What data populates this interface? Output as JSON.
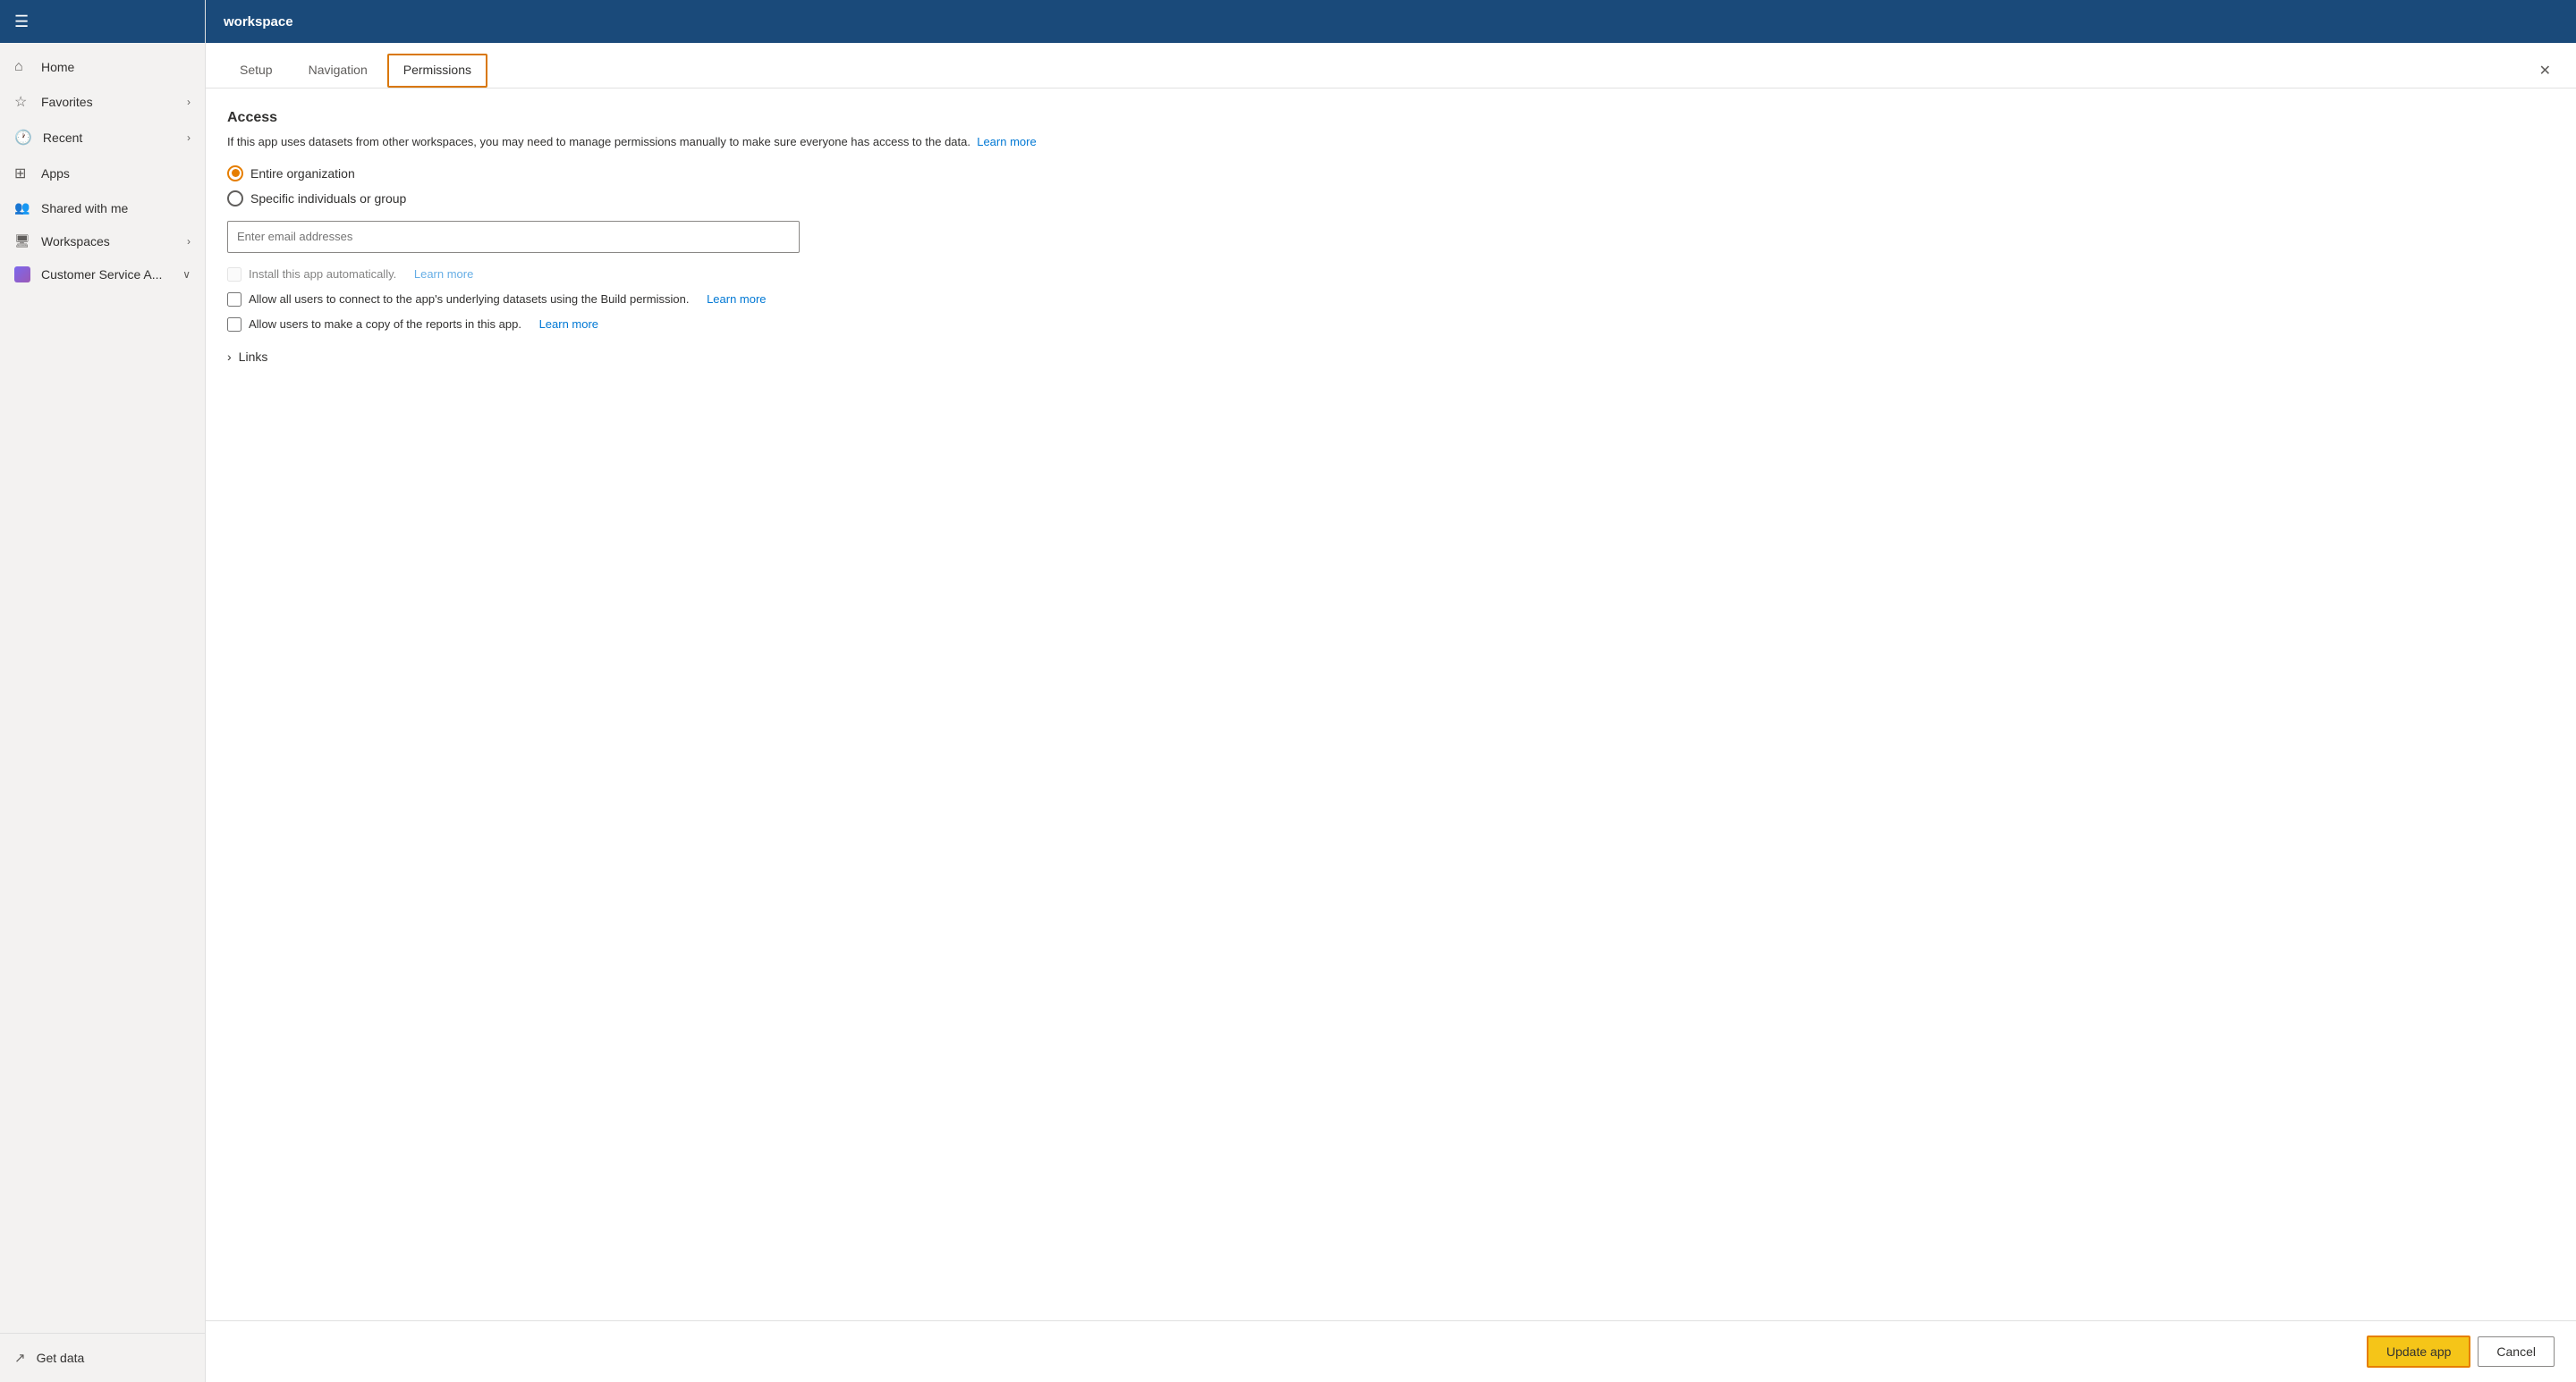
{
  "app_title": "workspace",
  "sidebar": {
    "menu_icon": "☰",
    "items": [
      {
        "id": "home",
        "label": "Home",
        "icon": "⌂"
      },
      {
        "id": "favorites",
        "label": "Favorites",
        "icon": "☆",
        "has_chevron": true
      },
      {
        "id": "recent",
        "label": "Recent",
        "icon": "🕐",
        "has_chevron": true
      },
      {
        "id": "apps",
        "label": "Apps",
        "icon": "⊞"
      },
      {
        "id": "shared",
        "label": "Shared with me",
        "icon": "👥"
      },
      {
        "id": "workspaces",
        "label": "Workspaces",
        "icon": "🖥",
        "has_chevron": true
      },
      {
        "id": "customer-service",
        "label": "Customer Service A...",
        "icon": "ws",
        "has_chevron": true
      }
    ],
    "footer": [
      {
        "id": "get-data",
        "label": "Get data",
        "icon": "↗"
      }
    ]
  },
  "tabs": [
    {
      "id": "setup",
      "label": "Setup",
      "active": false
    },
    {
      "id": "navigation",
      "label": "Navigation",
      "active": false
    },
    {
      "id": "permissions",
      "label": "Permissions",
      "active": true
    }
  ],
  "content": {
    "section_title": "Access",
    "section_desc": "If this app uses datasets from other workspaces, you may need to manage permissions manually to make sure everyone has access to the data.",
    "learn_more_1": "Learn more",
    "radio_entire_org": "Entire organization",
    "radio_specific": "Specific individuals or group",
    "email_placeholder": "Enter email addresses",
    "checkbox_install_label": "Install this app automatically.",
    "checkbox_install_learn_more": "Learn more",
    "checkbox_allow_connect_label": "Allow all users to connect to the app's underlying datasets using the Build permission.",
    "checkbox_allow_connect_learn_more": "Learn more",
    "checkbox_allow_copy_label": "Allow users to make a copy of the reports in this app.",
    "checkbox_allow_copy_learn_more": "Learn more",
    "links_section": "Links"
  },
  "footer": {
    "update_label": "Update app",
    "cancel_label": "Cancel"
  }
}
